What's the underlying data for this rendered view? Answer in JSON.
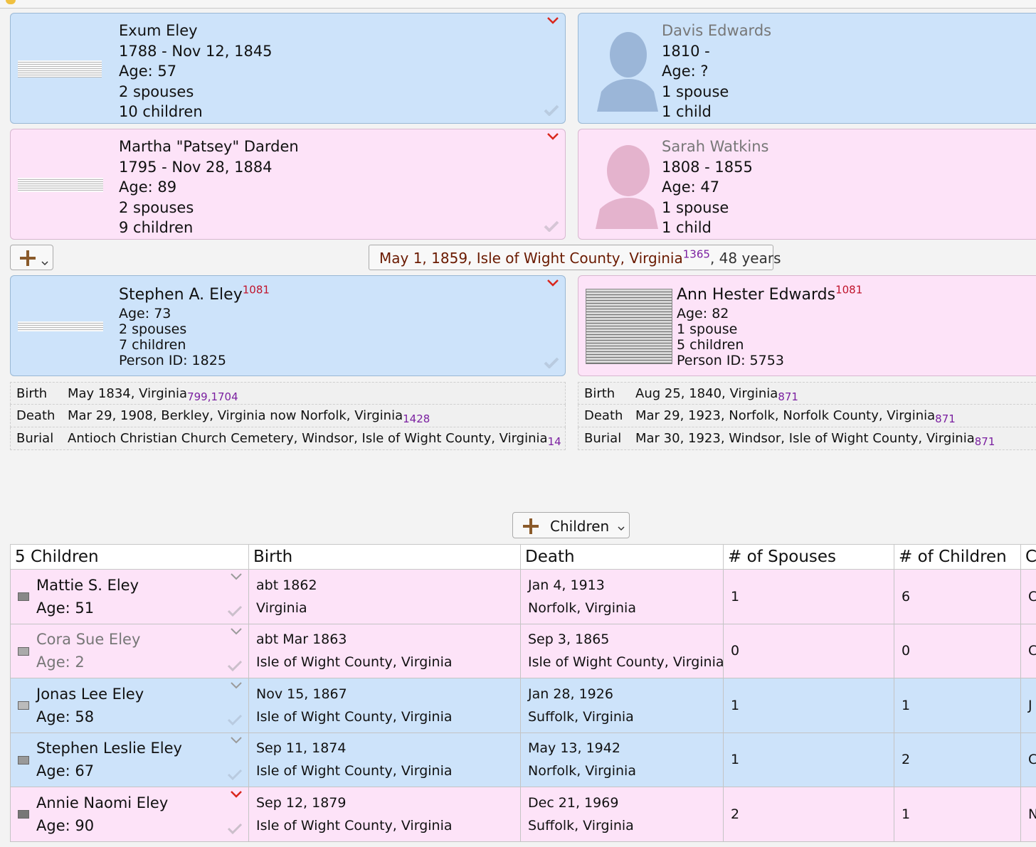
{
  "parents": {
    "father_father": {
      "name": "Exum Eley",
      "dates": "1788 - Nov 12, 1845",
      "age": "Age: 57",
      "spouses": "2 spouses",
      "children": "10 children"
    },
    "father_mother": {
      "name": "Martha \"Patsey\" Darden",
      "dates": "1795 - Nov 28, 1884",
      "age": "Age: 89",
      "spouses": "2 spouses",
      "children": "9 children"
    },
    "mother_father": {
      "name": "Davis Edwards",
      "dates": "1810 -",
      "age": "Age: ?",
      "spouses": "1 spouse",
      "children": "1 child"
    },
    "mother_mother": {
      "name": "Sarah Watkins",
      "dates": "1808 - 1855",
      "age": "Age: 47",
      "spouses": "1 spouse",
      "children": "1 child"
    }
  },
  "marriage": {
    "text": "May 1, 1859, Isle of Wight County, Virginia",
    "source": "1365",
    "years": ", 48 years"
  },
  "husband": {
    "name": "Stephen A. Eley",
    "source": "1081",
    "age": "Age: 73",
    "spouses": "2 spouses",
    "children": "7 children",
    "person_id": "Person ID: 1825",
    "facts": [
      {
        "label": "Birth",
        "value": "May 1834, Virginia",
        "source": "799,1704"
      },
      {
        "label": "Death",
        "value": "Mar 29, 1908, Berkley, Virginia now Norfolk, Virginia",
        "source": "1428"
      },
      {
        "label": "Burial",
        "value": "Antioch Christian Church Cemetery, Windsor, Isle of Wight County, Virginia",
        "source": "14"
      }
    ]
  },
  "wife": {
    "name": "Ann Hester Edwards",
    "source": "1081",
    "age": "Age: 82",
    "spouses": "1 spouse",
    "children": "5 children",
    "person_id": "Person ID: 5753",
    "facts": [
      {
        "label": "Birth",
        "value": "Aug 25, 1840, Virginia",
        "source": "871"
      },
      {
        "label": "Death",
        "value": "Mar 29, 1923, Norfolk, Norfolk County, Virginia",
        "source": "871"
      },
      {
        "label": "Burial",
        "value": "Mar 30, 1923, Windsor, Isle of Wight County, Virginia",
        "source": "871"
      }
    ]
  },
  "children_button": {
    "label": "Children"
  },
  "children_table": {
    "headers": [
      "5 Children",
      "Birth",
      "Death",
      "# of Spouses",
      "# of Children",
      "C"
    ],
    "rows": [
      {
        "name": "Mattie S. Eley",
        "age": "Age: 51",
        "birth_date": "abt 1862",
        "birth_place": "Virginia",
        "death_date": "Jan 4, 1913",
        "death_place": "Norfolk, Virginia",
        "spouses": "1",
        "children": "6",
        "extra": "C"
      },
      {
        "name": "Cora Sue Eley",
        "age": "Age: 2",
        "birth_date": "abt Mar 1863",
        "birth_place": "Isle of Wight County, Virginia",
        "death_date": "Sep 3, 1865",
        "death_place": "Isle of Wight County, Virginia",
        "spouses": "0",
        "children": "0",
        "extra": "C"
      },
      {
        "name": "Jonas Lee Eley",
        "age": "Age: 58",
        "birth_date": "Nov 15, 1867",
        "birth_place": "Isle of Wight County, Virginia",
        "death_date": "Jan 28, 1926",
        "death_place": "Suffolk, Virginia",
        "spouses": "1",
        "children": "1",
        "extra": "J"
      },
      {
        "name": "Stephen Leslie Eley",
        "age": "Age: 67",
        "birth_date": "Sep 11, 1874",
        "birth_place": "Isle of Wight County, Virginia",
        "death_date": "May 13, 1942",
        "death_place": "Norfolk, Virginia",
        "spouses": "1",
        "children": "2",
        "extra": "C"
      },
      {
        "name": "Annie Naomi Eley",
        "age": "Age: 90",
        "birth_date": "Sep 12, 1879",
        "birth_place": "Isle of Wight County, Virginia",
        "death_date": "Dec 21, 1969",
        "death_place": "Suffolk, Virginia",
        "spouses": "2",
        "children": "1",
        "extra": "N"
      }
    ]
  },
  "colors": {
    "male": "#cde3fa",
    "female": "#fde3f8",
    "chevron_active": "#d9261c",
    "source_red": "#c0142c",
    "source_purple": "#7a1fa0",
    "marriage_text": "#6a1a00"
  },
  "icons": [
    "chevron-down-icon",
    "check-icon",
    "plus-icon",
    "silhouette-male-icon",
    "silhouette-female-icon"
  ]
}
